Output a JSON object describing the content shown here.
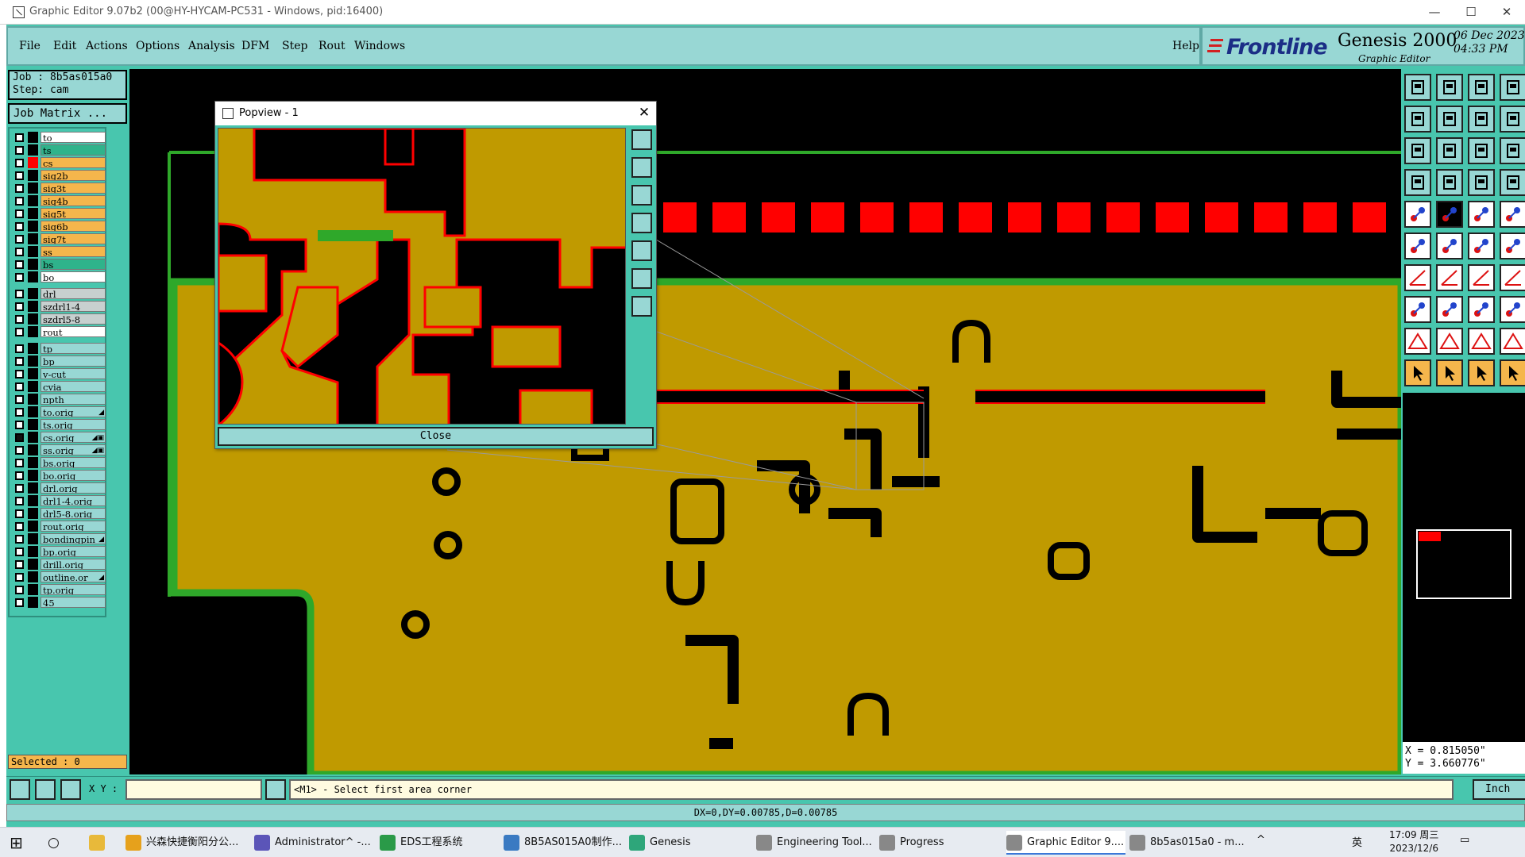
{
  "window": {
    "title": "Graphic Editor 9.07b2 (00@HY-HYCAM-PC531 - Windows, pid:16400)",
    "min": "—",
    "max": "☐",
    "close": "✕"
  },
  "menu": {
    "items": [
      "File",
      "Edit",
      "Actions",
      "Options",
      "Analysis",
      "DFM",
      "Step",
      "Rout",
      "Windows"
    ],
    "help": "Help"
  },
  "brand": {
    "logo": "Frontline",
    "product": "Genesis 2000",
    "subtitle": "Graphic Editor",
    "date": "06 Dec 2023",
    "time": "04:33 PM"
  },
  "job": {
    "job_line": "Job : 8b5as015a0",
    "step_line": "Step: cam",
    "matrix_button": "Job Matrix ..."
  },
  "layers": [
    {
      "name": "to",
      "style": "white",
      "swatch": "#000000",
      "checked": false
    },
    {
      "name": "ts",
      "style": "green",
      "swatch": "#000000",
      "checked": false
    },
    {
      "name": "cs",
      "style": "orange",
      "swatch": "#ff0000",
      "checked": false
    },
    {
      "name": "sig2b",
      "style": "orange",
      "swatch": "#000000",
      "checked": false
    },
    {
      "name": "sig3t",
      "style": "orange",
      "swatch": "#000000",
      "checked": false
    },
    {
      "name": "sig4b",
      "style": "orange",
      "swatch": "#000000",
      "checked": false
    },
    {
      "name": "sig5t",
      "style": "orange",
      "swatch": "#000000",
      "checked": false
    },
    {
      "name": "sig6b",
      "style": "orange",
      "swatch": "#000000",
      "checked": false
    },
    {
      "name": "sig7t",
      "style": "orange",
      "swatch": "#000000",
      "checked": false
    },
    {
      "name": "ss",
      "style": "orange",
      "swatch": "#000000",
      "checked": false
    },
    {
      "name": "bs",
      "style": "green",
      "swatch": "#000000",
      "checked": false
    },
    {
      "name": "bo",
      "style": "white",
      "swatch": "#000000",
      "checked": false
    },
    {
      "name": "drl",
      "style": "grey",
      "swatch": "#000000",
      "checked": false
    },
    {
      "name": "szdrl1-4",
      "style": "grey",
      "swatch": "#000000",
      "checked": false
    },
    {
      "name": "szdrl5-8",
      "style": "grey",
      "swatch": "#000000",
      "checked": false
    },
    {
      "name": "rout",
      "style": "white",
      "swatch": "#000000",
      "checked": false
    },
    {
      "name": "tp",
      "style": "teal",
      "swatch": "#000000",
      "checked": false
    },
    {
      "name": "bp",
      "style": "teal",
      "swatch": "#000000",
      "checked": false
    },
    {
      "name": "v-cut",
      "style": "teal",
      "swatch": "#000000",
      "checked": false
    },
    {
      "name": "cvia",
      "style": "teal",
      "swatch": "#000000",
      "checked": false
    },
    {
      "name": "npth",
      "style": "teal",
      "swatch": "#000000",
      "checked": false
    },
    {
      "name": "to.orig",
      "style": "teal",
      "swatch": "#000000",
      "checked": false,
      "mark": "◢"
    },
    {
      "name": "ts.orig",
      "style": "teal",
      "swatch": "#000000",
      "checked": false
    },
    {
      "name": "cs.orig",
      "style": "teal",
      "swatch": "#000000",
      "checked": true,
      "mark": "◢▣"
    },
    {
      "name": "ss.orig",
      "style": "teal",
      "swatch": "#000000",
      "checked": false,
      "mark": "◢▣"
    },
    {
      "name": "bs.orig",
      "style": "teal",
      "swatch": "#000000",
      "checked": false
    },
    {
      "name": "bo.orig",
      "style": "teal",
      "swatch": "#000000",
      "checked": false
    },
    {
      "name": "drl.orig",
      "style": "teal",
      "swatch": "#000000",
      "checked": false
    },
    {
      "name": "drl1-4.orig",
      "style": "teal",
      "swatch": "#000000",
      "checked": false
    },
    {
      "name": "drl5-8.orig",
      "style": "teal",
      "swatch": "#000000",
      "checked": false
    },
    {
      "name": "rout.orig",
      "style": "teal",
      "swatch": "#000000",
      "checked": false
    },
    {
      "name": "bondingpin",
      "style": "teal",
      "swatch": "#000000",
      "checked": false,
      "mark": "◢"
    },
    {
      "name": "bp.orig",
      "style": "teal",
      "swatch": "#000000",
      "checked": false
    },
    {
      "name": "drill.orig",
      "style": "teal",
      "swatch": "#000000",
      "checked": false
    },
    {
      "name": "outline.or",
      "style": "teal",
      "swatch": "#000000",
      "checked": false,
      "mark": "◢"
    },
    {
      "name": "tp.orig",
      "style": "teal",
      "swatch": "#000000",
      "checked": false
    },
    {
      "name": "45",
      "style": "teal",
      "swatch": "#000000",
      "checked": false
    }
  ],
  "selected": "Selected : 0",
  "popview": {
    "title": "Popview - 1",
    "close_x": "✕",
    "close_button": "Close"
  },
  "coords": {
    "x": "X = 0.815050\"",
    "y": "Y = 3.660776\""
  },
  "command": {
    "xy_label": "X Y :",
    "xy_value": "",
    "message": "<M1> - Select first area corner",
    "unit": "Inch"
  },
  "status": "DX=0,DY=0.00785,D=0.00785",
  "taskbar": {
    "items": [
      {
        "label": "兴森快捷衡阳分公...",
        "icon": "#e6a11c"
      },
      {
        "label": "Administrator^ -...",
        "icon": "#5b55b8"
      },
      {
        "label": "EDS工程系统",
        "icon": "#2a9a48"
      },
      {
        "label": "8B5AS015A0制作...",
        "icon": "#3a7ac2"
      },
      {
        "label": "Genesis",
        "icon": "#2ea67a"
      },
      {
        "label": "Engineering Tool...",
        "icon": "#888888"
      },
      {
        "label": "Progress",
        "icon": "#888888"
      },
      {
        "label": "Graphic Editor 9....",
        "icon": "#888888",
        "active": true
      },
      {
        "label": "8b5as015a0 - m...",
        "icon": "#888888"
      }
    ],
    "clock_time": "17:09 周三",
    "clock_date": "2023/12/6",
    "ime": "英"
  },
  "colors": {
    "app_bg": "#48c6ae",
    "panel": "#98d7d4",
    "copper": "#c09a00",
    "outline_red": "#ff0000",
    "green": "#2fa82a"
  }
}
